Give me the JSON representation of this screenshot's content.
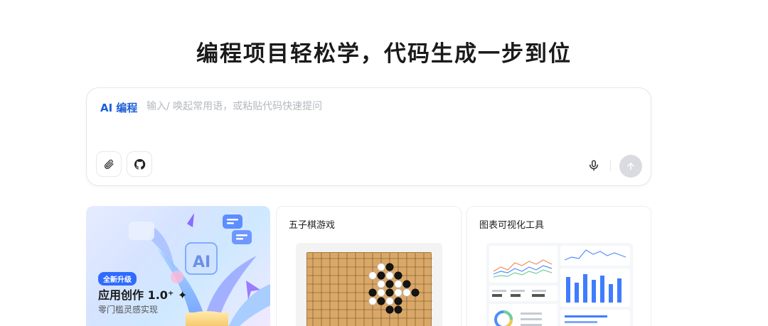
{
  "headline": "编程项目轻松学，代码生成一步到位",
  "prompt": {
    "mode": "AI 编程",
    "placeholder": "输入/ 唤起常用语，或粘贴代码快速提问",
    "value": ""
  },
  "toolbar": {
    "attach_icon": "paperclip-icon",
    "github_icon": "github-icon",
    "mic_icon": "microphone-icon",
    "send_icon": "arrow-up-icon"
  },
  "cards": [
    {
      "badge": "全新升级",
      "title": "应用创作 1.0⁺ ✦",
      "subtitle": "零门槛灵感实现"
    },
    {
      "title": "五子棋游戏"
    },
    {
      "title": "图表可视化工具"
    }
  ],
  "colors": {
    "accent": "#1c5fd6",
    "badge": "#2f6bff",
    "send_disabled": "#d9dbe0",
    "board": "#d9a868"
  },
  "board_stones": {
    "black": [
      [
        5,
        1
      ],
      [
        6,
        2
      ],
      [
        4,
        2
      ],
      [
        5,
        3
      ],
      [
        7,
        3
      ],
      [
        5,
        4
      ],
      [
        3,
        4
      ],
      [
        6,
        5
      ],
      [
        4,
        5
      ],
      [
        5,
        6
      ],
      [
        6,
        6
      ],
      [
        8,
        4
      ]
    ],
    "white": [
      [
        4,
        1
      ],
      [
        3,
        2
      ],
      [
        5,
        2
      ],
      [
        4,
        3
      ],
      [
        6,
        3
      ],
      [
        6,
        4
      ],
      [
        4,
        4
      ],
      [
        7,
        4
      ],
      [
        5,
        5
      ],
      [
        3,
        5
      ]
    ]
  }
}
